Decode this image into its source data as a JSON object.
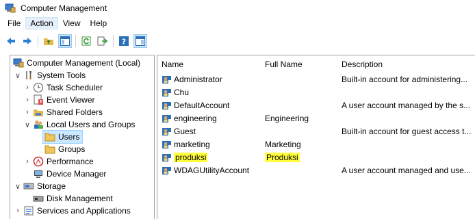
{
  "window": {
    "title": "Computer Management"
  },
  "menu": [
    "File",
    "Action",
    "View",
    "Help"
  ],
  "toolbar": {
    "icons": [
      "back-arrow-icon",
      "forward-arrow-icon",
      "up-folder-icon",
      "show-hide-tree-icon",
      "refresh-icon",
      "export-list-icon",
      "help-icon",
      "properties-pane-icon"
    ]
  },
  "tree": [
    {
      "label": "Computer Management (Local)"
    },
    {
      "label": "System Tools"
    },
    {
      "label": "Task Scheduler"
    },
    {
      "label": "Event Viewer"
    },
    {
      "label": "Shared Folders"
    },
    {
      "label": "Local Users and Groups"
    },
    {
      "label": "Users"
    },
    {
      "label": "Groups"
    },
    {
      "label": "Performance"
    },
    {
      "label": "Device Manager"
    },
    {
      "label": "Storage"
    },
    {
      "label": "Disk Management"
    },
    {
      "label": "Services and Applications"
    }
  ],
  "list": {
    "columns": [
      "Name",
      "Full Name",
      "Description"
    ],
    "rows": [
      {
        "name": "Administrator",
        "full_name": "",
        "description": "Built-in account for administering..."
      },
      {
        "name": "Chu",
        "full_name": "",
        "description": ""
      },
      {
        "name": "DefaultAccount",
        "full_name": "",
        "description": "A user account managed by the s..."
      },
      {
        "name": "engineering",
        "full_name": "Engineering",
        "description": ""
      },
      {
        "name": "Guest",
        "full_name": "",
        "description": "Built-in account for guest access t..."
      },
      {
        "name": "marketing",
        "full_name": "Marketing",
        "description": ""
      },
      {
        "name": "produksi",
        "full_name": "Produksi",
        "description": ""
      },
      {
        "name": "WDAGUtilityAccount",
        "full_name": "",
        "description": "A user account managed and use..."
      }
    ]
  },
  "colors": {
    "highlight": "#fffe3a",
    "selection": "#cce8ff"
  }
}
